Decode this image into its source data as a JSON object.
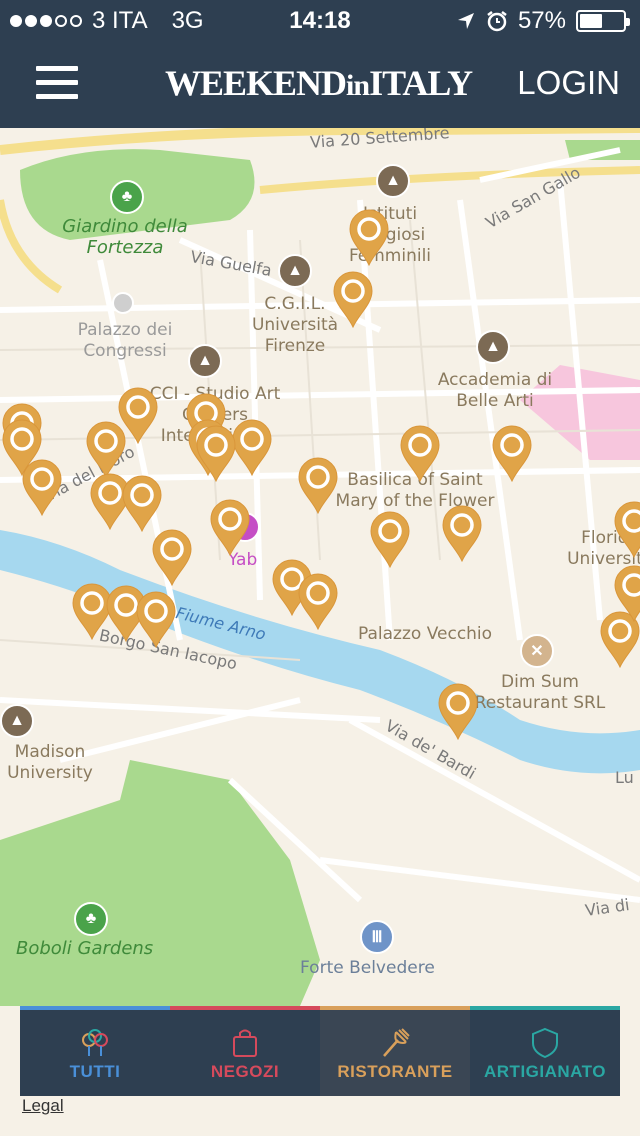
{
  "status_bar": {
    "carrier": "3 ITA",
    "network": "3G",
    "time": "14:18",
    "battery": "57%",
    "battery_level": 0.57,
    "signal_bars_filled": 3,
    "signal_bars_total": 5,
    "icons": [
      "location-arrow-icon",
      "alarm-icon",
      "battery-icon"
    ]
  },
  "header": {
    "brand_weekend": "WEEKEND",
    "brand_in": "in",
    "brand_italy": "ITALY",
    "login_label": "LOGIN",
    "menu_icon": "hamburger-menu-icon"
  },
  "map": {
    "places": {
      "giardino": "Giardino della Fortezza",
      "istituti": "Istituti Religiosi Femminili",
      "cgil": "C.G.I.L. Università Firenze",
      "palazzo_congressi": "Palazzo dei Congressi",
      "accademia": "Accademia di Belle Arti",
      "studio_art": "CCI - Studio Art Centers International",
      "basilica": "Basilica of Saint Mary of the Flower",
      "yab": "Yab",
      "florida": "Florida University",
      "palazzo_vecchio": "Palazzo Vecchio",
      "dim_sum": "Dim Sum Restaurant SRL",
      "madison": "Madison University",
      "boboli": "Boboli Gardens",
      "forte": "Forte Belvedere"
    },
    "streets": {
      "via_20": "Via 20 Settembre",
      "via_san_gallo": "Via San Gallo",
      "via_guelfa": "Via Guelfa",
      "fiume_arno": "Fiume Arno",
      "borgo": "Borgo San Iacopo",
      "via_bardi": "Via de' Bardi",
      "via_del_moro": "Via del Moro",
      "via_di": "Via di",
      "lu": "Lu"
    }
  },
  "tabs": [
    {
      "label": "TUTTI",
      "color": "#4a90d9",
      "icon": "all-pins-icon",
      "active": false
    },
    {
      "label": "NEGOZI",
      "color": "#d64a5c",
      "icon": "shopping-bag-icon",
      "active": false
    },
    {
      "label": "RISTORANTE",
      "color": "#d9a05b",
      "icon": "fork-icon",
      "active": true
    },
    {
      "label": "ARTIGIANATO",
      "color": "#2aa7a3",
      "icon": "shield-icon",
      "active": false
    }
  ],
  "legal_label": "Legal",
  "colors": {
    "header_bg": "#2e3f51",
    "pin": "#e0a448",
    "river": "#a6d8ef",
    "park": "#a9d98e",
    "map_bg": "#f6f1e7"
  }
}
